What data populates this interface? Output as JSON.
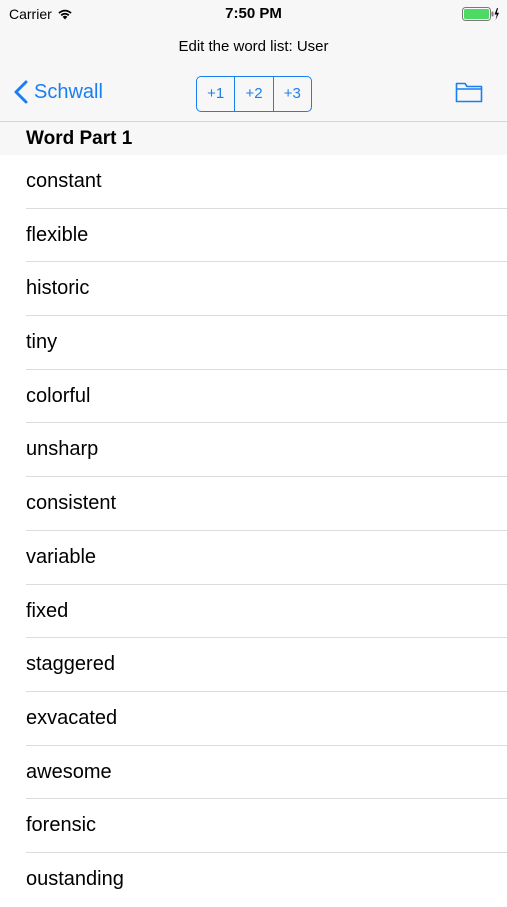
{
  "status_bar": {
    "carrier": "Carrier",
    "time": "7:50 PM",
    "battery_color": "#4cd964"
  },
  "nav": {
    "title": "Edit the word list: User",
    "back_label": "Schwall",
    "segments": [
      "+1",
      "+2",
      "+3"
    ],
    "accent_color": "#1a7ff2",
    "right_icon": "folder-icon"
  },
  "section": {
    "header": "Word Part 1"
  },
  "words": [
    "constant",
    "flexible",
    "historic",
    "tiny",
    "colorful",
    "unsharp",
    "consistent",
    "variable",
    "fixed",
    "staggered",
    "exvacated",
    "awesome",
    "forensic",
    "oustanding"
  ]
}
